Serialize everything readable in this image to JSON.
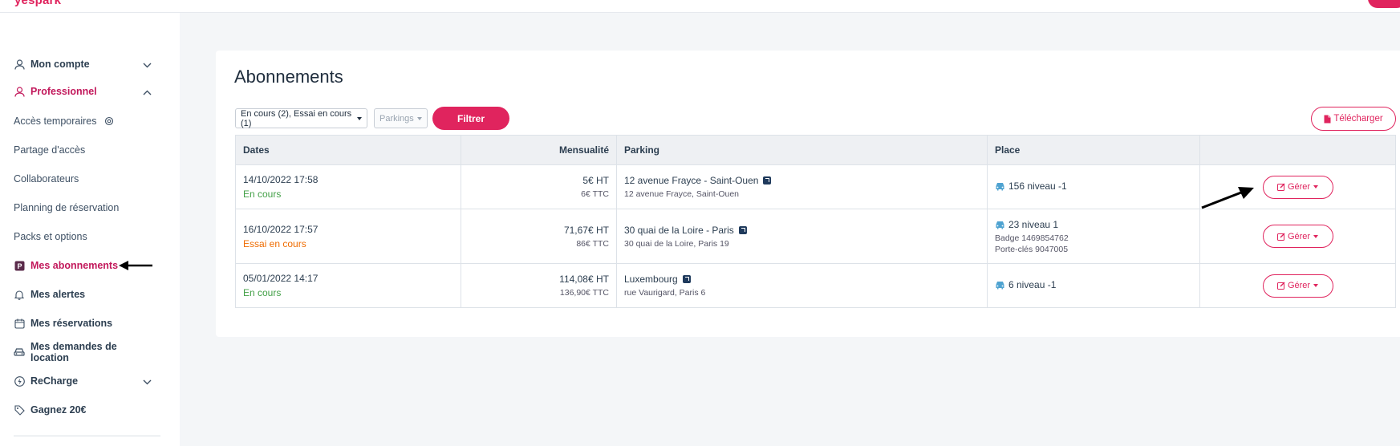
{
  "app": {
    "logo": "yespark"
  },
  "topnav": {
    "text": ""
  },
  "sidebar": {
    "items": [
      {
        "label": "Mon compte",
        "icon": "user-icon",
        "chevron": "down",
        "style": "strong"
      },
      {
        "label": "Professionnel",
        "icon": "user-icon",
        "chevron": "up",
        "style": "active"
      },
      {
        "label": "Accès temporaires",
        "icon": "",
        "extra_icon": "gear-icon",
        "style": "normal"
      },
      {
        "label": "Partage d'accès",
        "icon": "",
        "style": "normal"
      },
      {
        "label": "Collaborateurs",
        "icon": "",
        "style": "normal"
      },
      {
        "label": "Planning de réservation",
        "icon": "",
        "style": "normal"
      },
      {
        "label": "Packs et options",
        "icon": "",
        "style": "normal"
      },
      {
        "label": "Mes abonnements",
        "icon": "parking-icon",
        "style": "active"
      },
      {
        "label": "Mes alertes",
        "icon": "bell-icon",
        "style": "strong"
      },
      {
        "label": "Mes réservations",
        "icon": "calendar-icon",
        "style": "strong"
      },
      {
        "label": "Mes demandes de location",
        "icon": "car-icon",
        "style": "strong"
      },
      {
        "label": "ReCharge",
        "icon": "bolt-icon",
        "chevron": "down",
        "style": "strong"
      },
      {
        "label": "Gagnez 20€",
        "icon": "tag-icon",
        "style": "strong"
      }
    ]
  },
  "main": {
    "title": "Abonnements",
    "filters": {
      "status_select": "En cours (2), Essai en cours (1)",
      "parkings_select": "Parkings",
      "filter_button": "Filtrer",
      "download_button": "Télécharger"
    },
    "table": {
      "headers": [
        "Dates",
        "Mensualité",
        "Parking",
        "Place",
        ""
      ],
      "rows": [
        {
          "date": "14/10/2022 17:58",
          "status": "En cours",
          "status_color": "#43a047",
          "price_ht": "5€ HT",
          "price_ttc": "6€ TTC",
          "parking_name": "12 avenue Frayce - Saint-Ouen",
          "parking_address": "12 avenue Frayce, Saint-Ouen",
          "place": "156 niveau -1",
          "place_extra": [],
          "action": "Gérer"
        },
        {
          "date": "16/10/2022 17:57",
          "status": "Essai en cours",
          "status_color": "#ef6c00",
          "price_ht": "71,67€ HT",
          "price_ttc": "86€ TTC",
          "parking_name": "30 quai de la Loire - Paris",
          "parking_address": "30 quai de la Loire, Paris 19",
          "place": "23 niveau 1",
          "place_extra": [
            "Badge 1469854762",
            "Porte-clés 9047005"
          ],
          "action": "Gérer"
        },
        {
          "date": "05/01/2022 14:17",
          "status": "En cours",
          "status_color": "#43a047",
          "price_ht": "114,08€ HT",
          "price_ttc": "136,90€ TTC",
          "parking_name": "Luxembourg",
          "parking_address": "rue Vaurigard, Paris 6",
          "place": "6 niveau -1",
          "place_extra": [],
          "action": "Gérer"
        }
      ]
    }
  },
  "colors": {
    "accent": "#e0245e",
    "active_text": "#c2185b",
    "car_icon": "#4fa3d1"
  }
}
